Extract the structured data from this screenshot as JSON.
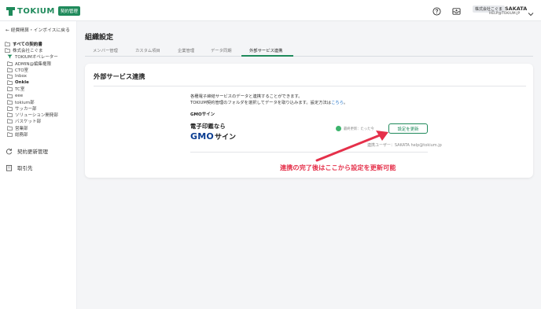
{
  "brand": {
    "name": "TOKIUM",
    "badge": "契約管理",
    "color": "#1f8a5b"
  },
  "header": {
    "company": "株式会社こぐま",
    "user_name": "SAKATA",
    "user_email": "HELP@TOKIUM.JP",
    "icons": [
      "help-icon",
      "inbox-icon",
      "chevron-down-icon"
    ]
  },
  "sidebar": {
    "back_label": "← 経費精算・インボイスに戻る",
    "root_label": "すべての契約書",
    "company_folder": "株式会社こぐま",
    "folders": [
      {
        "label": "TOKIUMオペレーター",
        "icon": "filter-icon",
        "bold": false
      },
      {
        "label": "ADMIN@編集権限",
        "icon": "folder-icon",
        "bold": false
      },
      {
        "label": "CTO室",
        "icon": "folder-icon",
        "bold": false
      },
      {
        "label": "Inbox",
        "icon": "folder-icon",
        "bold": false
      },
      {
        "label": "Onkle",
        "icon": "folder-icon",
        "bold": true
      },
      {
        "label": "TC室",
        "icon": "folder-icon",
        "bold": false
      },
      {
        "label": "eee",
        "icon": "folder-icon",
        "bold": false
      },
      {
        "label": "tokium部",
        "icon": "folder-icon",
        "bold": false
      },
      {
        "label": "サッカー部",
        "icon": "folder-icon",
        "bold": false
      },
      {
        "label": "ソリューション開発部",
        "icon": "folder-icon",
        "bold": false
      },
      {
        "label": "バスケット部",
        "icon": "folder-icon",
        "bold": false
      },
      {
        "label": "営業部",
        "icon": "folder-icon",
        "bold": false
      },
      {
        "label": "総務部",
        "icon": "folder-icon",
        "bold": false
      }
    ],
    "nav": [
      {
        "label": "契約更新管理",
        "icon": "renew-icon"
      },
      {
        "label": "取引先",
        "icon": "building-icon"
      }
    ]
  },
  "main": {
    "title": "組織設定",
    "tabs": [
      "メンバー管理",
      "カスタム項目",
      "企業管理",
      "データ同期",
      "外部サービス連携"
    ],
    "active_tab": "外部サービス連携",
    "card": {
      "title": "外部サービス連携",
      "desc_line1": "各種電子締結サービスのデータと連携することができます。",
      "desc_line2": "TOKIUM契約管理のフォルダを選択してデータを取り込みます。設定方法は",
      "desc_link": "こちら",
      "desc_end": "。",
      "service_label": "GMOサイン",
      "logo_top": "電子印鑑なら",
      "logo_gmo": "GMO",
      "logo_sign": "サイン",
      "status_text": "最終更新：たった今",
      "button_label": "設定を更新",
      "linked_user": "連携ユーザー：SAKATA help@tokium.jp"
    }
  },
  "annotation": {
    "text": "連携の完了後はここから設定を更新可能",
    "color": "#e5304a"
  }
}
